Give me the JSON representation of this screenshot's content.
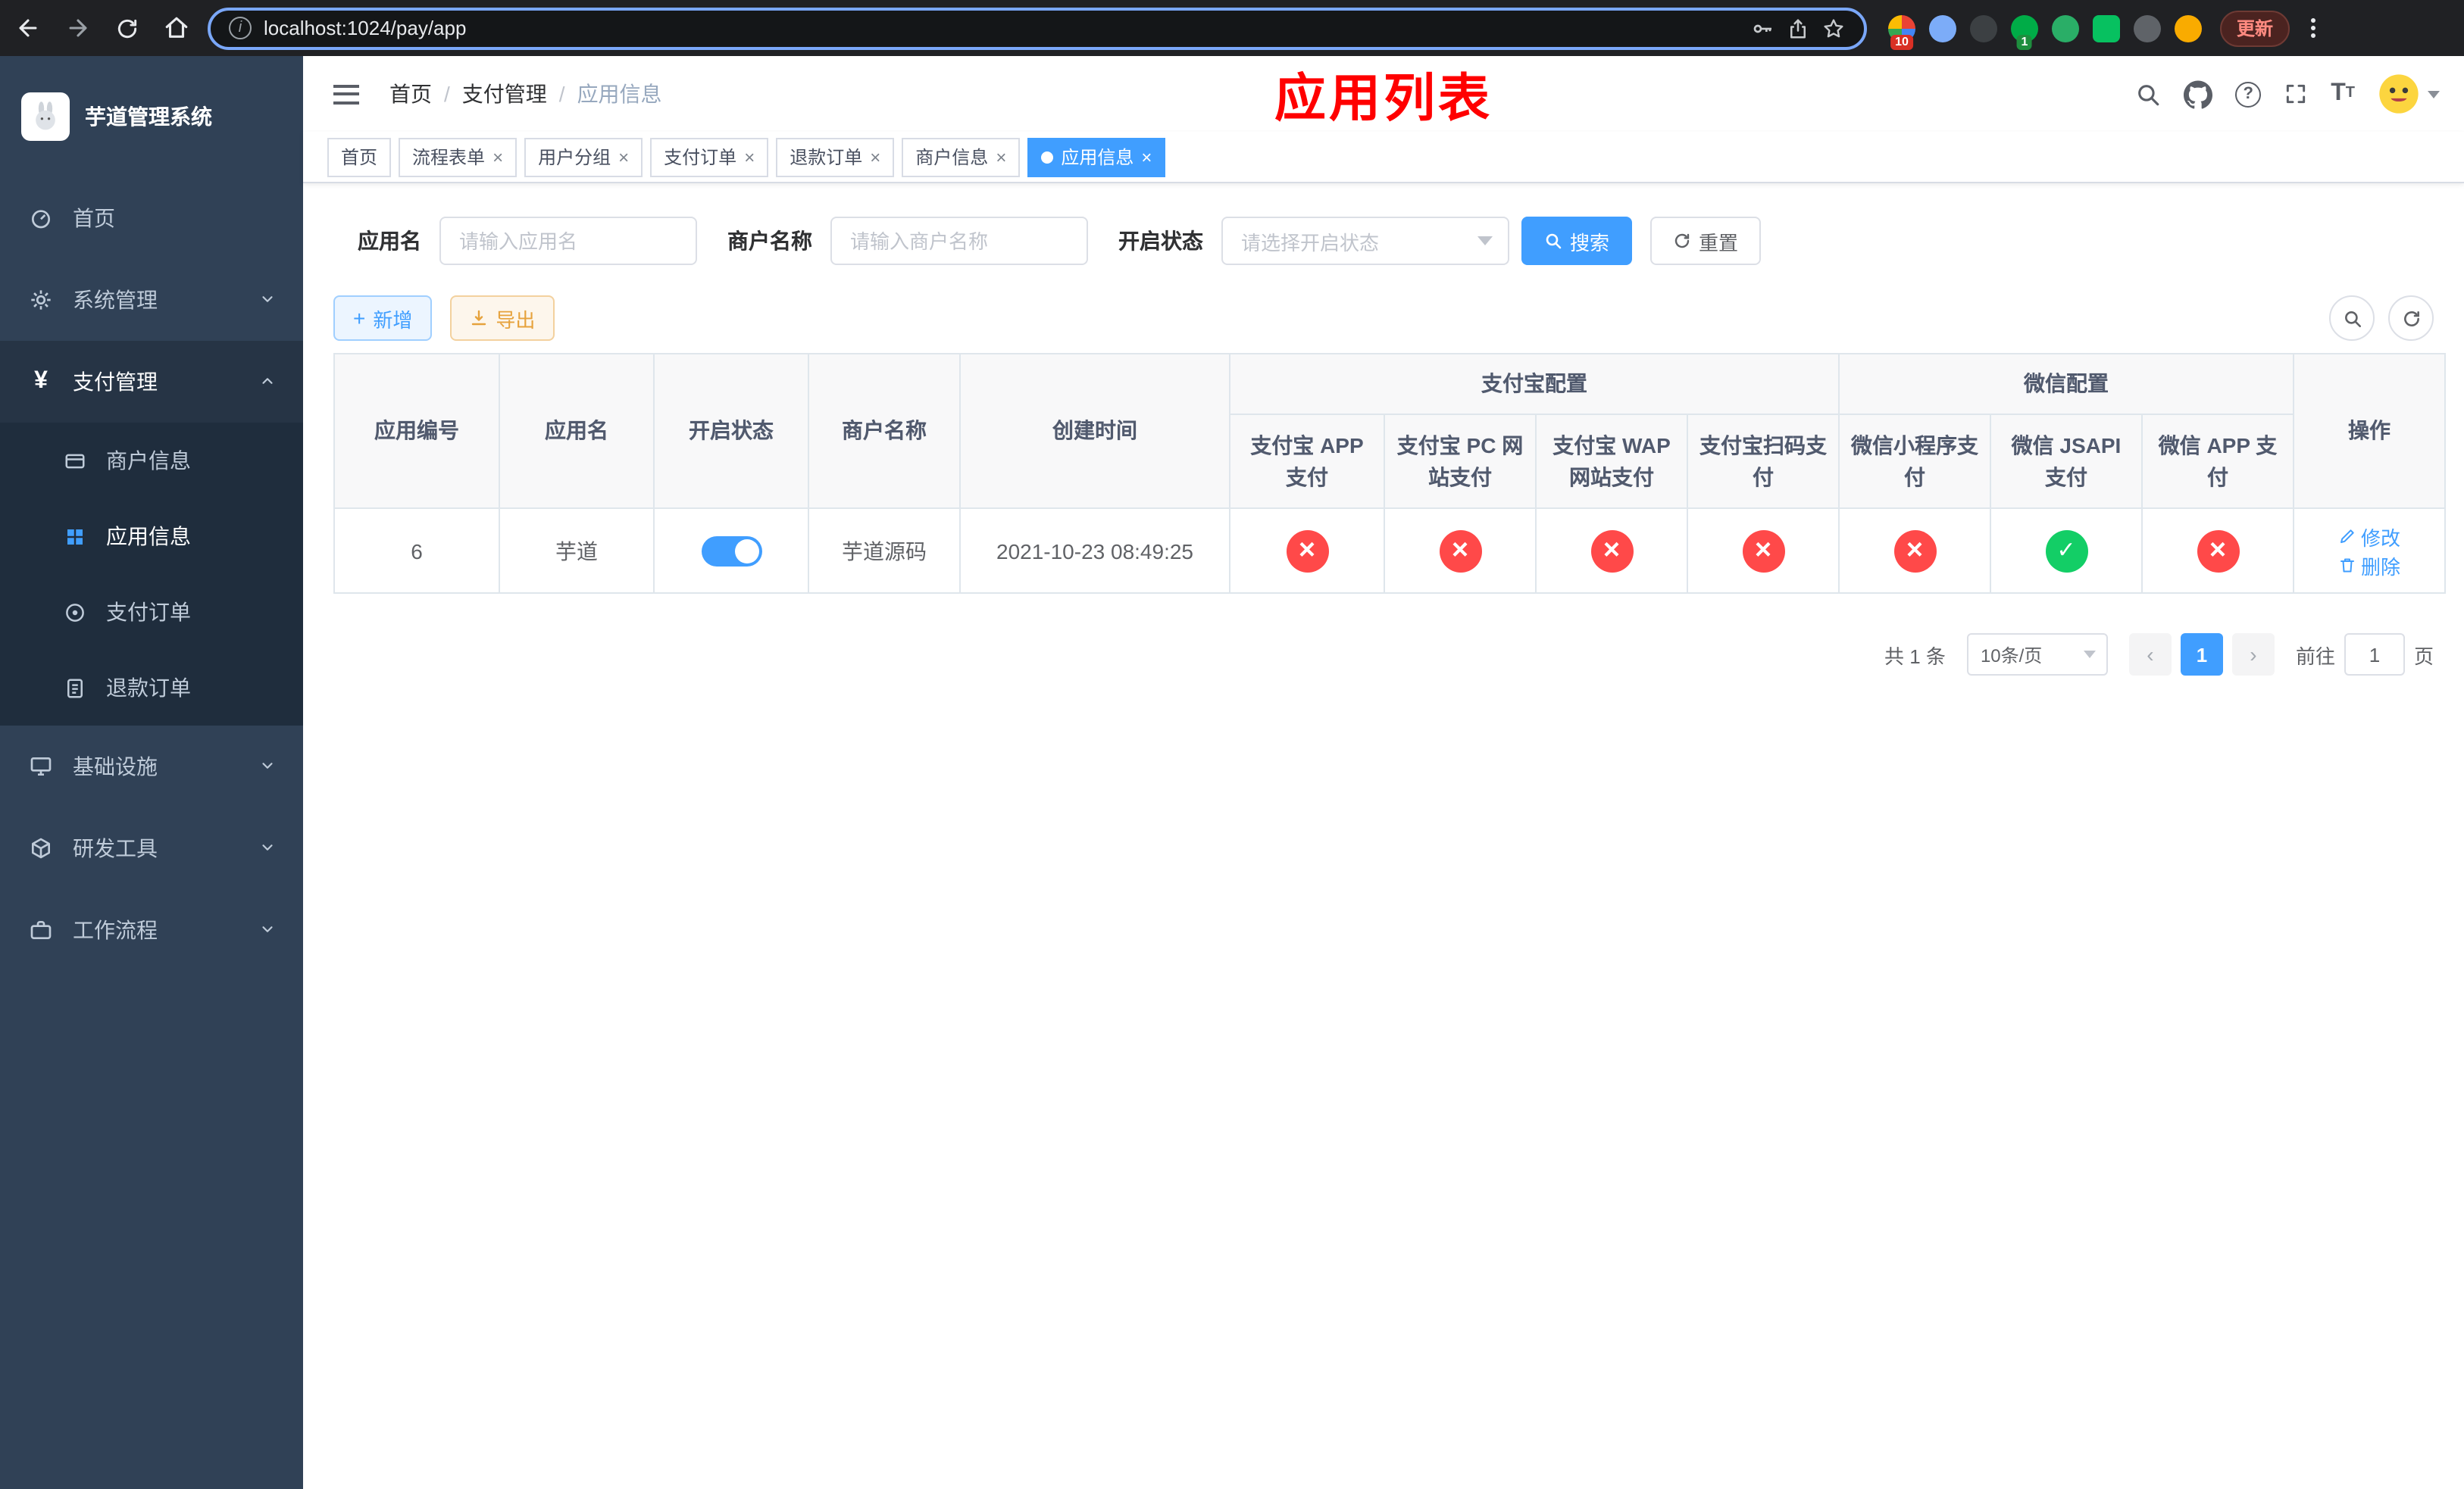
{
  "browser": {
    "url": "localhost:1024/pay/app",
    "update_label": "更新",
    "ext_badge_red": "10",
    "ext_badge_green": "1"
  },
  "sidebar": {
    "app_title": "芋道管理系统",
    "items": {
      "home": "首页",
      "system": "系统管理",
      "payment": "支付管理",
      "infra": "基础设施",
      "devtools": "研发工具",
      "workflow": "工作流程"
    },
    "payment_children": {
      "merchant": "商户信息",
      "app": "应用信息",
      "pay_order": "支付订单",
      "refund_order": "退款订单"
    }
  },
  "navbar": {
    "breadcrumb": {
      "home": "首页",
      "section": "支付管理",
      "current": "应用信息"
    },
    "page_title": "应用列表"
  },
  "tabs": {
    "t0": "首页",
    "t1": "流程表单",
    "t2": "用户分组",
    "t3": "支付订单",
    "t4": "退款订单",
    "t5": "商户信息",
    "t6": "应用信息"
  },
  "filters": {
    "app_name_label": "应用名",
    "app_name_placeholder": "请输入应用名",
    "merchant_label": "商户名称",
    "merchant_placeholder": "请输入商户名称",
    "status_label": "开启状态",
    "status_placeholder": "请选择开启状态",
    "search_label": "搜索",
    "reset_label": "重置"
  },
  "toolbar": {
    "add_label": "新增",
    "export_label": "导出"
  },
  "table": {
    "col_id": "应用编号",
    "col_name": "应用名",
    "col_status": "开启状态",
    "col_merchant": "商户名称",
    "col_created": "创建时间",
    "group_alipay": "支付宝配置",
    "group_wechat": "微信配置",
    "sub_alipay_app": "支付宝 APP 支付",
    "sub_alipay_pc": "支付宝 PC 网站支付",
    "sub_alipay_wap": "支付宝 WAP 网站支付",
    "sub_alipay_qr": "支付宝扫码支付",
    "sub_wechat_mini": "微信小程序支付",
    "sub_wechat_jsapi": "微信 JSAPI 支付",
    "sub_wechat_app": "微信 APP 支付",
    "col_actions": "操作",
    "row": {
      "id": "6",
      "name": "芋道",
      "enabled": true,
      "merchant": "芋道源码",
      "created": "2021-10-23 08:49:25",
      "statuses": [
        "fail",
        "fail",
        "fail",
        "fail",
        "fail",
        "ok",
        "fail"
      ],
      "edit_label": "修改",
      "delete_label": "删除"
    }
  },
  "pagination": {
    "total_text": "共 1 条",
    "page_size": "10条/页",
    "current_page": "1",
    "goto_label": "前往",
    "goto_value": "1",
    "page_unit": "页"
  },
  "colors": {
    "primary": "#409eff",
    "danger": "#ff4949",
    "success": "#13ce66",
    "warning": "#e6a23c",
    "title_red": "#ff0000",
    "sidebar_bg": "#304156",
    "submenu_bg": "#1f2d3d"
  }
}
